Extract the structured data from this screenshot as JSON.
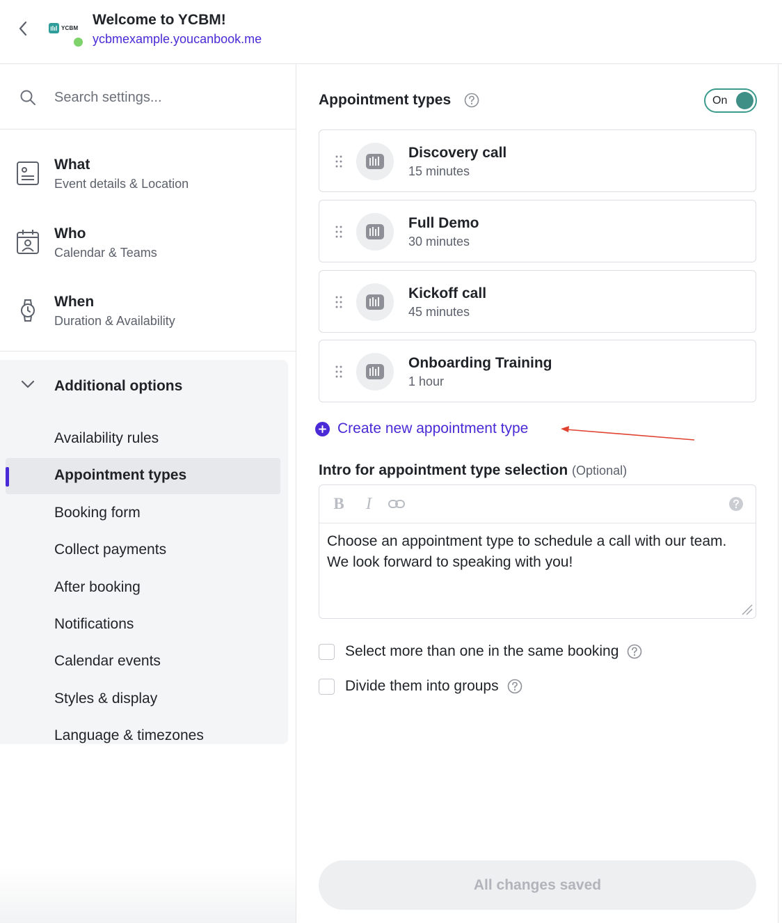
{
  "header": {
    "title": "Welcome to YCBM!",
    "url": "ycbmexample.youcanbook.me",
    "logo_text": "YCBM",
    "status_color": "#7dd36a"
  },
  "sidebar": {
    "search": {
      "placeholder": "Search settings..."
    },
    "nav": [
      {
        "title": "What",
        "subtitle": "Event details & Location",
        "icon": "form-icon"
      },
      {
        "title": "Who",
        "subtitle": "Calendar & Teams",
        "icon": "calendar-person-icon"
      },
      {
        "title": "When",
        "subtitle": "Duration & Availability",
        "icon": "watch-icon"
      }
    ],
    "additional_options": {
      "title": "Additional options",
      "items": [
        {
          "label": "Availability rules"
        },
        {
          "label": "Appointment types",
          "active": true
        },
        {
          "label": "Booking form"
        },
        {
          "label": "Collect payments"
        },
        {
          "label": "After booking"
        },
        {
          "label": "Notifications"
        },
        {
          "label": "Calendar events"
        },
        {
          "label": "Styles & display"
        },
        {
          "label": "Language & timezones"
        }
      ]
    },
    "accent_color": "#4a2ad6"
  },
  "main": {
    "section_title": "Appointment types",
    "toggle": {
      "label": "On",
      "state": "on",
      "color": "#3f8f86"
    },
    "appointment_types": [
      {
        "name": "Discovery call",
        "duration": "15 minutes"
      },
      {
        "name": "Full Demo",
        "duration": "30 minutes"
      },
      {
        "name": "Kickoff call",
        "duration": "45 minutes"
      },
      {
        "name": "Onboarding Training",
        "duration": "1 hour"
      }
    ],
    "create_link": "Create new appointment type",
    "intro": {
      "label": "Intro for appointment type selection",
      "optional": "(Optional)",
      "text": "Choose an appointment type to schedule a call with our team. We look forward to speaking with you!",
      "toolbar": {
        "bold": "B",
        "italic": "I"
      }
    },
    "options": [
      {
        "label": "Select more than one in the same booking",
        "checked": false
      },
      {
        "label": "Divide them into groups",
        "checked": false
      }
    ],
    "save_status": "All changes saved"
  }
}
